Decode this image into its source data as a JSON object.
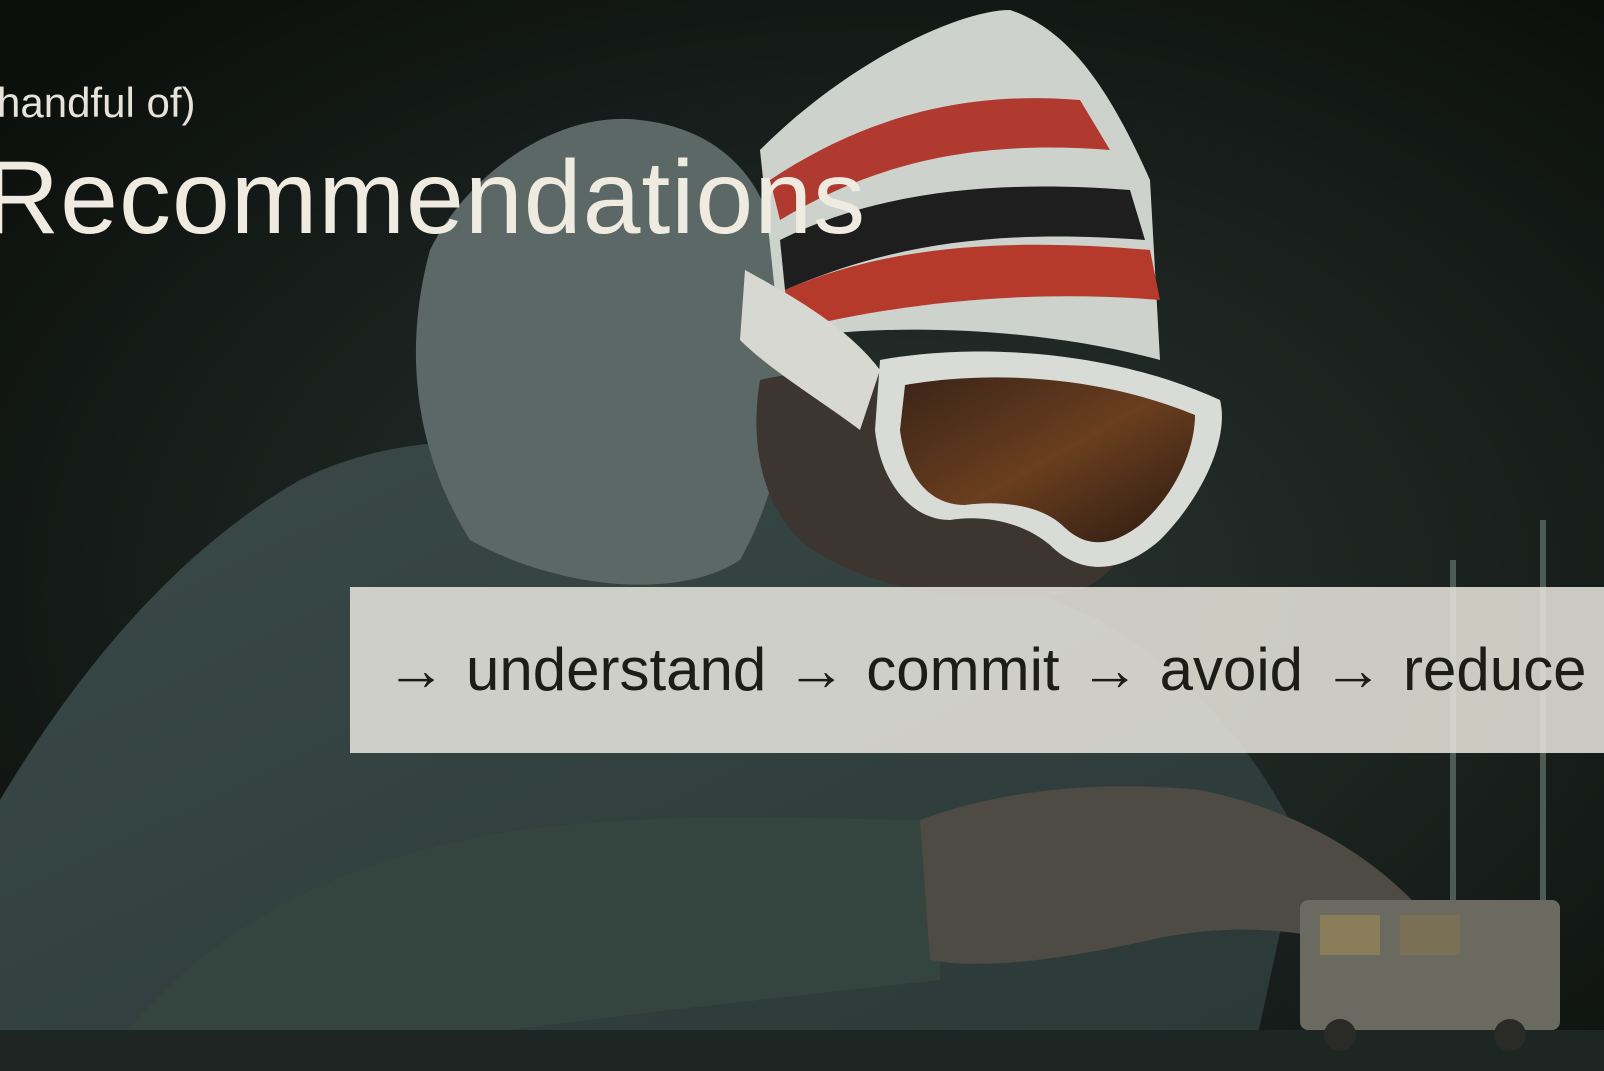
{
  "slide": {
    "subtitle": "handful of)",
    "title": "Recommendations"
  },
  "steps": [
    {
      "arrow": "→",
      "label": "understand"
    },
    {
      "arrow": "→",
      "label": "commit"
    },
    {
      "arrow": "→",
      "label": "avoid"
    },
    {
      "arrow": "→",
      "label": "reduce"
    }
  ],
  "colors": {
    "background": "#0d110e",
    "title_text": "#efebe0",
    "bar_fill": "#e4e3d9",
    "bar_text": "#1d1d18"
  }
}
